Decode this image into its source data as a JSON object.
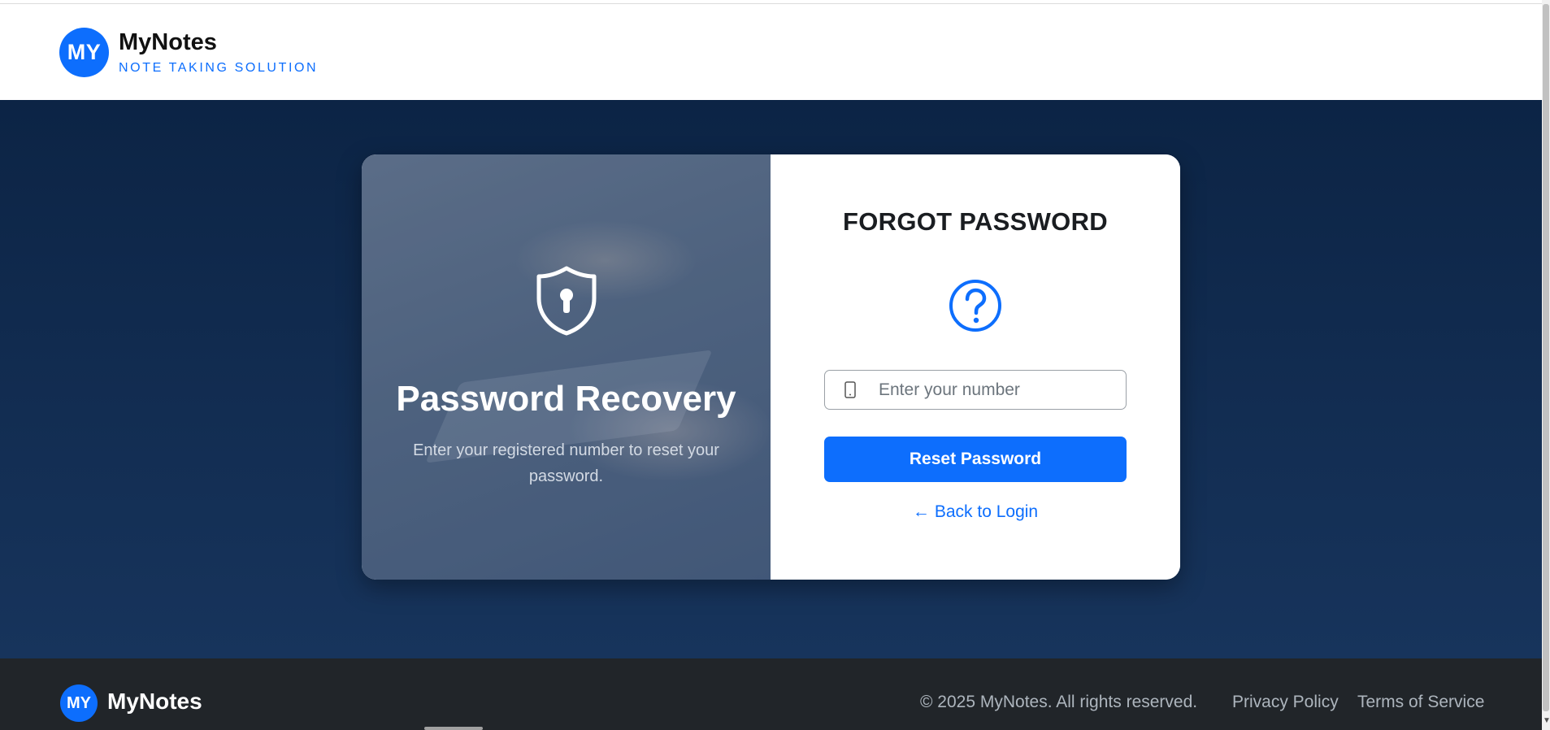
{
  "header": {
    "logo_text": "MY",
    "brand_name": "MyNotes",
    "tagline": "NOTE TAKING SOLUTION"
  },
  "left_panel": {
    "icon": "shield-keyhole-icon",
    "title": "Password Recovery",
    "subtitle": "Enter your registered number to reset your password."
  },
  "form": {
    "title": "FORGOT PASSWORD",
    "icon": "question-circle-icon",
    "number_field": {
      "icon": "phone-icon",
      "placeholder": "Enter your number",
      "value": ""
    },
    "reset_button_label": "Reset Password",
    "back_link_arrow": "←",
    "back_link_label": "Back to Login"
  },
  "footer": {
    "logo_text": "MY",
    "brand_name": "MyNotes",
    "copyright": "© 2025 MyNotes. All rights reserved.",
    "links": [
      "Privacy Policy",
      "Terms of Service"
    ]
  },
  "colors": {
    "accent": "#0d6efd",
    "main_background": "#0c2445",
    "footer_background": "#212529"
  }
}
